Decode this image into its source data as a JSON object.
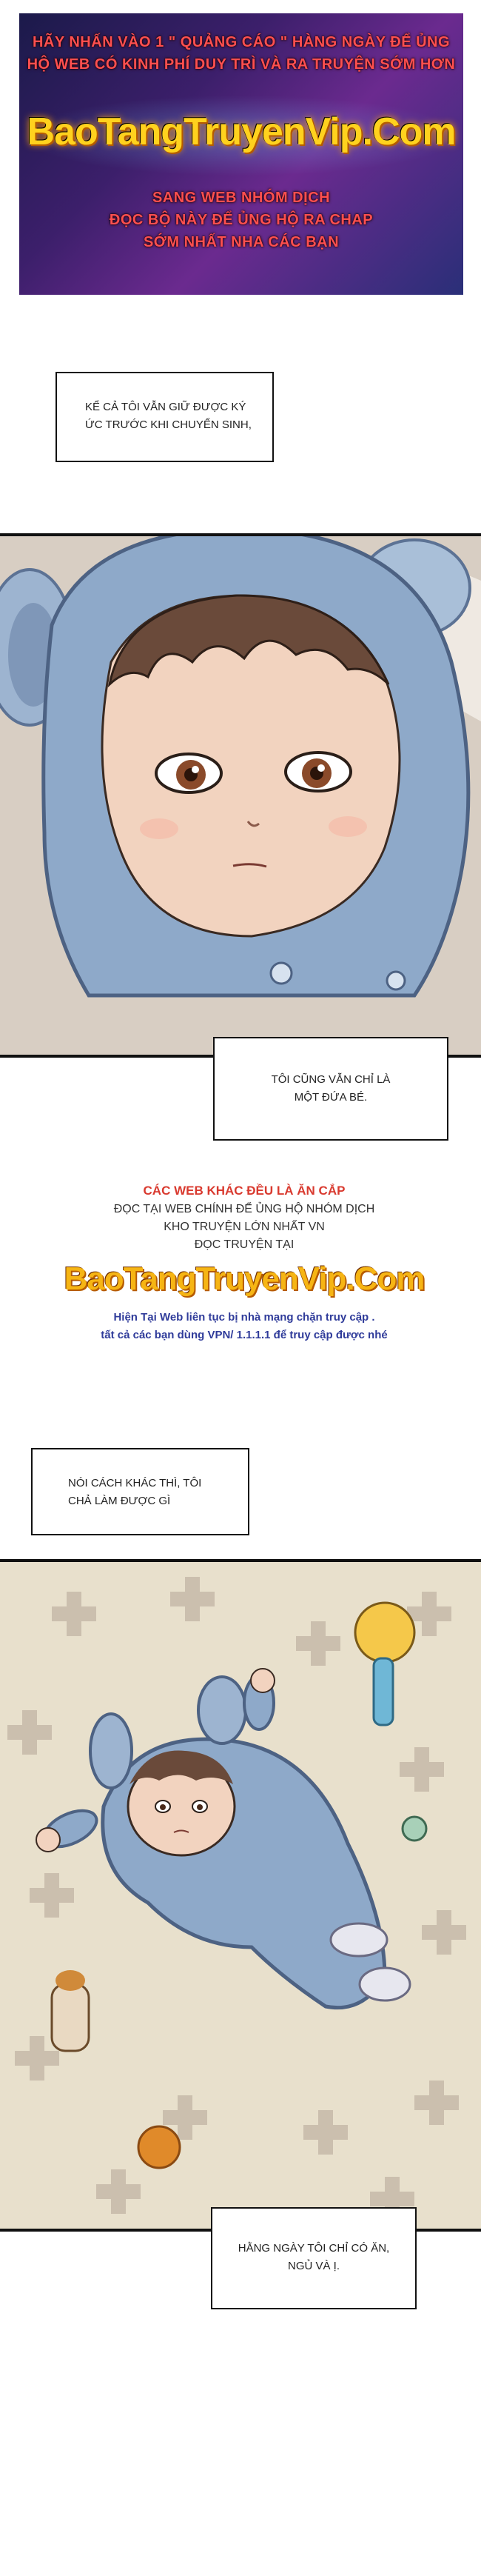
{
  "banner": {
    "line1": "HÃY NHẤN VÀO 1 \" QUẢNG CÁO \" HÀNG NGÀY ĐỂ ỦNG",
    "line2": "HỘ WEB CÓ KINH PHÍ DUY TRÌ VÀ RA TRUYỆN SỚM HƠN",
    "brand": "BaoTangTruyenVip.Com",
    "line3": "SANG WEB NHÓM DỊCH",
    "line4": "ĐỌC BỘ NÀY ĐỂ ỦNG HỘ RA CHAP",
    "line5": "SỚM NHẤT NHA CÁC BẠN"
  },
  "captions": {
    "c1": [
      "KỂ CẢ TÔI VẪN GIỮ ĐƯỢC KÝ",
      "ỨC TRƯỚC KHI CHUYỂN SINH,"
    ],
    "c2": [
      "TÔI CŨNG VẪN CHỈ LÀ",
      "MỘT ĐỨA BÉ."
    ],
    "c3": [
      "NÓI CÁCH KHÁC THÌ, TÔI",
      "CHẢ LÀM ĐƯỢC GÌ"
    ],
    "c4": [
      "HẰNG NGÀY TÔI CHỈ CÓ ĂN,",
      "NGỦ VÀ Ị."
    ]
  },
  "ad": {
    "t1": "CÁC WEB KHÁC ĐỀU LÀ ĂN CẮP",
    "t2": "ĐỌC TẠI WEB CHÍNH ĐỂ ỦNG HỘ NHÓM DỊCH",
    "t3": "KHO TRUYỆN LỚN NHẤT VN",
    "t4": "ĐỌC TRUYỆN TẠI",
    "brand": "BaoTangTruyenVip.Com",
    "t5": "Hiện Tại Web liên tục bị nhà mạng chặn truy cập .",
    "t6": "tất cả các bạn dùng VPN/ 1.1.1.1 để truy cập được nhé"
  },
  "colors": {
    "banner_red": "#ff4f4f",
    "brand_yellow": "#ffd21e",
    "hoodie_blue": "#8ea9c9",
    "ad_red": "#d93a2f",
    "ad_blue": "#2f3b9a"
  }
}
